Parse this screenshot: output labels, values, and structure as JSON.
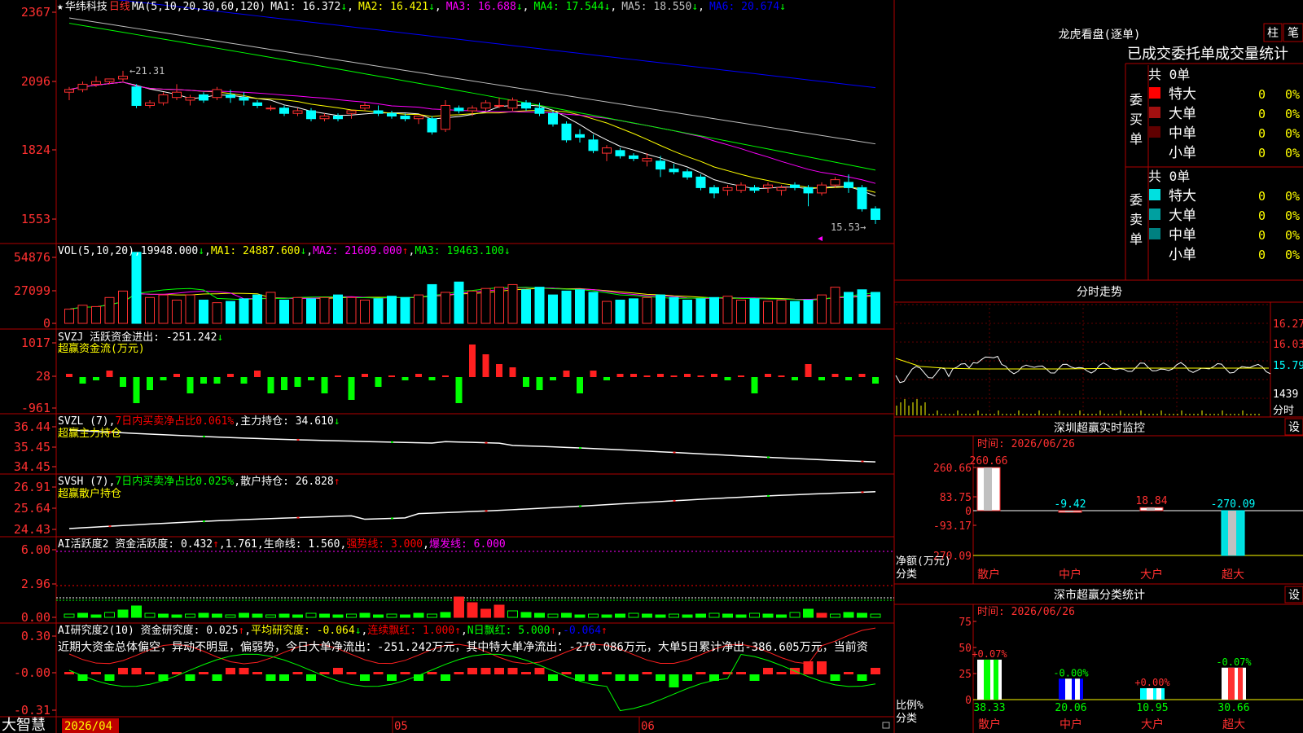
{
  "stock": {
    "name": "华纬科技",
    "period": "日线",
    "star": "★"
  },
  "footer": {
    "logo": "大智慧",
    "date": "2026/04",
    "m5": "05",
    "m6": "06"
  },
  "main": {
    "legend": [
      {
        "t": "MA(5,10,20,30,60,120)",
        "c": "#ffffff"
      },
      {
        "t": "MA1: 16.372",
        "c": "#ffffff",
        "a": "↓",
        "ac": "#00ff00"
      },
      {
        "t": "MA2: 16.421",
        "c": "#ffff00",
        "a": "↓",
        "ac": "#00ff00"
      },
      {
        "t": "MA3: 16.688",
        "c": "#ff00ff",
        "a": "↓",
        "ac": "#00ff00"
      },
      {
        "t": "MA4: 17.544",
        "c": "#00ff00",
        "a": "↓",
        "ac": "#00ff00"
      },
      {
        "t": "MA5: 18.550",
        "c": "#c0c0c0",
        "a": "↓",
        "ac": "#00ff00"
      },
      {
        "t": "MA6: 20.674",
        "c": "#0000ff",
        "a": "↓",
        "ac": "#00ff00"
      }
    ],
    "yticks": [
      "2367",
      "2096",
      "1824",
      "1553"
    ],
    "hi": "21.31",
    "lo": "15.53"
  },
  "vol": {
    "legend": [
      {
        "t": "VOL(5,10,20)",
        "c": "#ffffff"
      },
      {
        "t": "19948.000",
        "c": "#ffffff",
        "a": "↓",
        "ac": "#00ff00"
      },
      {
        "t": "MA1: 24887.600",
        "c": "#ffff00",
        "a": "↓",
        "ac": "#00ff00"
      },
      {
        "t": "MA2: 21609.000",
        "c": "#ff00ff",
        "a": "↑",
        "ac": "#ff0000"
      },
      {
        "t": "MA3: 19463.100",
        "c": "#00ff00",
        "a": "↓",
        "ac": "#00ff00"
      }
    ],
    "yticks": [
      "54876",
      "27099",
      "0"
    ]
  },
  "svzj": {
    "legend": [
      {
        "t": "SVZJ  活跃资金进出: -251.242",
        "c": "#ffffff",
        "a": "↓",
        "ac": "#00ff00"
      }
    ],
    "sub": "超赢资金流(万元)",
    "yticks": [
      "1017",
      "28",
      "-961"
    ]
  },
  "svzl": {
    "legend": [
      {
        "t": "SVZL (7)",
        "c": "#ffffff"
      },
      {
        "t": "7日内买卖净占比0.061%",
        "c": "#ff0000"
      },
      {
        "t": "主力持仓: 34.610",
        "c": "#ffffff",
        "a": "↓",
        "ac": "#00ff00"
      }
    ],
    "sub": "超赢主力持仓",
    "yticks": [
      "36.44",
      "35.45",
      "34.45"
    ]
  },
  "svsh": {
    "legend": [
      {
        "t": "SVSH (7)",
        "c": "#ffffff"
      },
      {
        "t": "7日内买卖净占比0.025%",
        "c": "#00ff00"
      },
      {
        "t": "散户持仓: 26.828",
        "c": "#ffffff",
        "a": "↑",
        "ac": "#ff0000"
      }
    ],
    "sub": "超赢散户持仓",
    "yticks": [
      "26.91",
      "25.64",
      "24.43"
    ]
  },
  "ai1": {
    "legend": [
      {
        "t": "AI活跃度2 资金活跃度: 0.432",
        "c": "#ffffff",
        "a": "↑",
        "ac": "#ff0000"
      },
      {
        "t": "1.761",
        "c": "#ffffff"
      },
      {
        "t": "生命线: 1.560",
        "c": "#ffffff"
      },
      {
        "t": "强势线: 3.000",
        "c": "#ff0000"
      },
      {
        "t": "爆发线: 6.000",
        "c": "#ff00ff"
      }
    ],
    "yticks": [
      "6.00",
      "2.96",
      "0.00"
    ]
  },
  "ai2": {
    "legend": [
      {
        "t": "AI研究度2(10) 资金研究度: 0.025",
        "c": "#ffffff",
        "a": "↑",
        "ac": "#ff0000"
      },
      {
        "t": "平均研究度: -0.064",
        "c": "#ffff00",
        "a": "↓",
        "ac": "#00ff00"
      },
      {
        "t": "连续飘红: 1.000",
        "c": "#ff0000",
        "a": "↑",
        "ac": "#ff0000"
      },
      {
        "t": "N日飘红: 5.000",
        "c": "#00ff00",
        "a": "↑",
        "ac": "#ff0000"
      },
      {
        "t": "-0.064",
        "c": "#0000ff",
        "a": "↑",
        "ac": "#ff0000"
      }
    ],
    "summary": "近期大资金总体偏空，异动不明显，偏弱势，今日大单净流出：-251.242万元，其中特大单净流出：-270.086万元，大单5日累计净出-386.605万元，当前资",
    "yticks": [
      "0.30",
      "-0.00",
      "-0.31"
    ]
  },
  "lhb": {
    "title": "龙虎看盘(逐单)",
    "btn1": "柱",
    "btn2": "笔",
    "header": "已成交委托单成交量统计",
    "buy": {
      "label": "委买单",
      "total": "共 0单",
      "rows": [
        {
          "c": "#ff0000",
          "l": "特大",
          "v": "0",
          "p": "0%"
        },
        {
          "c": "#a01010",
          "l": "大单",
          "v": "0",
          "p": "0%"
        },
        {
          "c": "#600000",
          "l": "中单",
          "v": "0",
          "p": "0%"
        },
        {
          "c": "",
          "l": "小单",
          "v": "0",
          "p": "0%"
        }
      ]
    },
    "sell": {
      "label": "委卖单",
      "total": "共 0单",
      "rows": [
        {
          "c": "#00e0e0",
          "l": "特大",
          "v": "0",
          "p": "0%"
        },
        {
          "c": "#00a0a0",
          "l": "大单",
          "v": "0",
          "p": "0%"
        },
        {
          "c": "#008080",
          "l": "中单",
          "v": "0",
          "p": "0%"
        },
        {
          "c": "",
          "l": "小单",
          "v": "0",
          "p": "0%"
        }
      ]
    }
  },
  "fenshi": {
    "title": "分时走势",
    "yticks": [
      "16.27",
      "16.03",
      "15.79",
      "1439"
    ],
    "bottom": "分时"
  },
  "monitor": {
    "title": "深圳超赢实时监控",
    "btn": "设",
    "time": "时间: 2026/06/26",
    "yticks": [
      "260.66",
      "83.75",
      "0",
      "-93.17",
      "-270.09"
    ],
    "ylabel1": "净额(万元)",
    "ylabel2": "分类",
    "chart_data": {
      "type": "bar",
      "categories": [
        "散户",
        "中户",
        "大户",
        "超大"
      ],
      "values": [
        260.66,
        -9.42,
        18.84,
        -270.09
      ],
      "labels": [
        "260.66",
        "-9.42",
        "18.84",
        "-270.09"
      ],
      "ylim": [
        -270.09,
        260.66
      ]
    }
  },
  "classify": {
    "title": "深市超赢分类统计",
    "btn": "设",
    "time": "时间: 2026/06/26",
    "yticks": [
      "75",
      "50",
      "25",
      "0"
    ],
    "ylabel1": "比例%",
    "ylabel2": "分类",
    "chart_data": {
      "type": "bar",
      "categories": [
        "散户",
        "中户",
        "大户",
        "超大"
      ],
      "values": [
        38.33,
        20.06,
        10.95,
        30.66
      ],
      "changes": [
        "+0.07%",
        "-0.00%",
        "+0.00%",
        "-0.07%"
      ],
      "ylim": [
        0,
        75
      ]
    }
  }
}
